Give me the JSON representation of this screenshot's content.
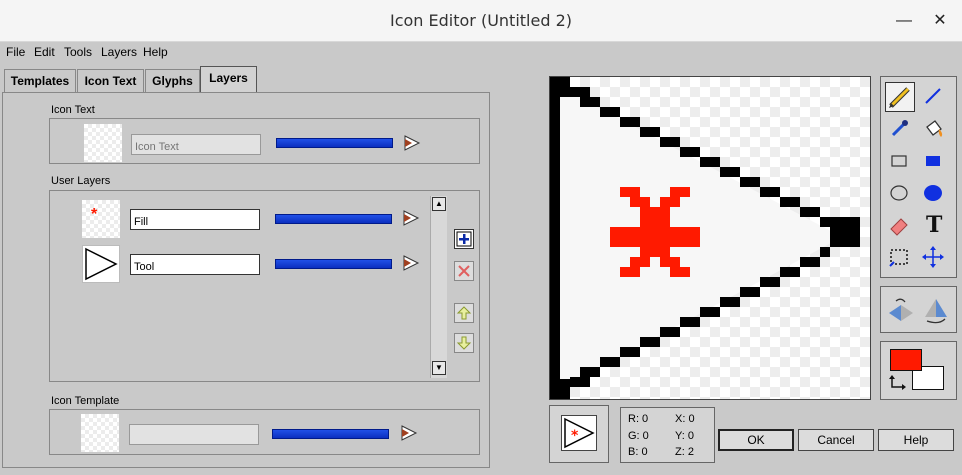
{
  "window": {
    "title": "Icon Editor (Untitled 2)",
    "minimize": "—",
    "close": "✕"
  },
  "menu": [
    "File",
    "Edit",
    "Tools",
    "Layers",
    "Help"
  ],
  "tabs": [
    "Templates",
    "Icon Text",
    "Glyphs",
    "Layers"
  ],
  "active_tab": "Layers",
  "icon_text_section": {
    "label": "Icon Text",
    "input_placeholder": "Icon Text",
    "input_value": ""
  },
  "user_layers_section": {
    "label": "User Layers",
    "layers": [
      {
        "name": "Fill",
        "thumb_glyph": "*"
      },
      {
        "name": "Tool"
      }
    ]
  },
  "icon_template_section": {
    "label": "Icon Template",
    "input_value": ""
  },
  "colors": {
    "foreground": "#ff1a00",
    "background": "#ffffff",
    "slider": "#1040d8"
  },
  "status": {
    "r": "R: 0",
    "g": "G: 0",
    "b": "B: 0",
    "x": "X: 0",
    "y": "Y: 0",
    "z": "Z: 2"
  },
  "buttons": {
    "ok": "OK",
    "cancel": "Cancel",
    "help": "Help"
  },
  "tools": [
    "pencil-tool",
    "line-tool",
    "dropper-tool",
    "fill-tool",
    "rectangle-tool",
    "filled-rectangle-tool",
    "ellipse-tool",
    "filled-ellipse-tool",
    "eraser-tool",
    "text-tool",
    "select-tool",
    "move-tool"
  ],
  "text_tool_glyph": "T"
}
